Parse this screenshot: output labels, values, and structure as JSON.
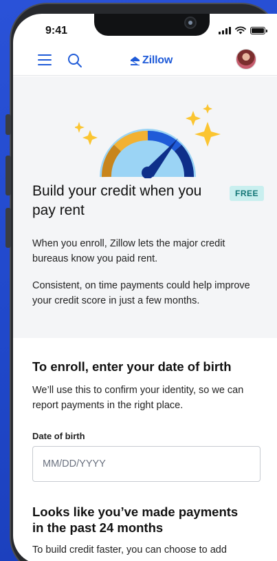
{
  "status_bar": {
    "time": "9:41"
  },
  "nav": {
    "logo_text": "Zillow"
  },
  "hero": {
    "badge": "FREE",
    "title": "Build your credit when you pay rent",
    "paragraph_1": "When you enroll, Zillow lets the major credit bureaus know you paid rent.",
    "paragraph_2": "Consistent, on time payments could help improve your credit score in just a few months."
  },
  "enroll": {
    "title": "To enroll, enter your date of birth",
    "description": "We’ll use this to confirm your identity, so we can report payments in the right place.",
    "dob_label": "Date of birth",
    "dob_placeholder": "MM/DD/YYYY",
    "dob_value": ""
  },
  "payments": {
    "title": "Looks like you’ve made payments in the past 24 months",
    "description": "To build credit faster, you can choose to add"
  },
  "colors": {
    "brand_blue": "#1f5bd8",
    "badge_bg": "#c9efef",
    "badge_text": "#117575",
    "hero_bg": "#f4f5f7"
  },
  "icons": [
    "menu-icon",
    "search-icon",
    "zillow-logo-icon",
    "gauge-icon",
    "sparkle-icon"
  ]
}
